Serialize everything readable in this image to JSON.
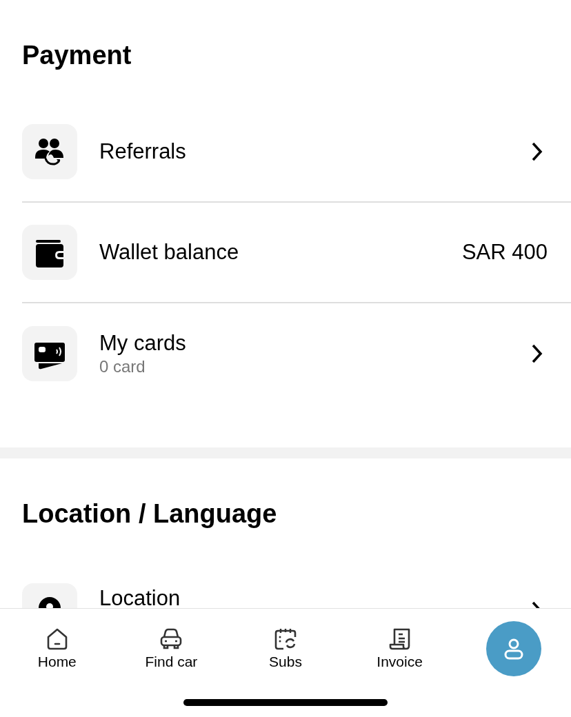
{
  "sections": [
    {
      "title": "Payment",
      "items": [
        {
          "kind": "chevron",
          "label": "Referrals"
        },
        {
          "kind": "value",
          "label": "Wallet balance",
          "value": "SAR 400"
        },
        {
          "kind": "chevron",
          "label": "My cards",
          "sublabel": "0 card"
        }
      ]
    },
    {
      "title": "Location / Language",
      "items": [
        {
          "kind": "chevron",
          "label": "Location"
        }
      ]
    }
  ],
  "nav": [
    {
      "label": "Home",
      "selected": false
    },
    {
      "label": "Find car",
      "selected": false
    },
    {
      "label": "Subs",
      "selected": false
    },
    {
      "label": "Invoice",
      "selected": false
    },
    {
      "selected": true
    }
  ]
}
